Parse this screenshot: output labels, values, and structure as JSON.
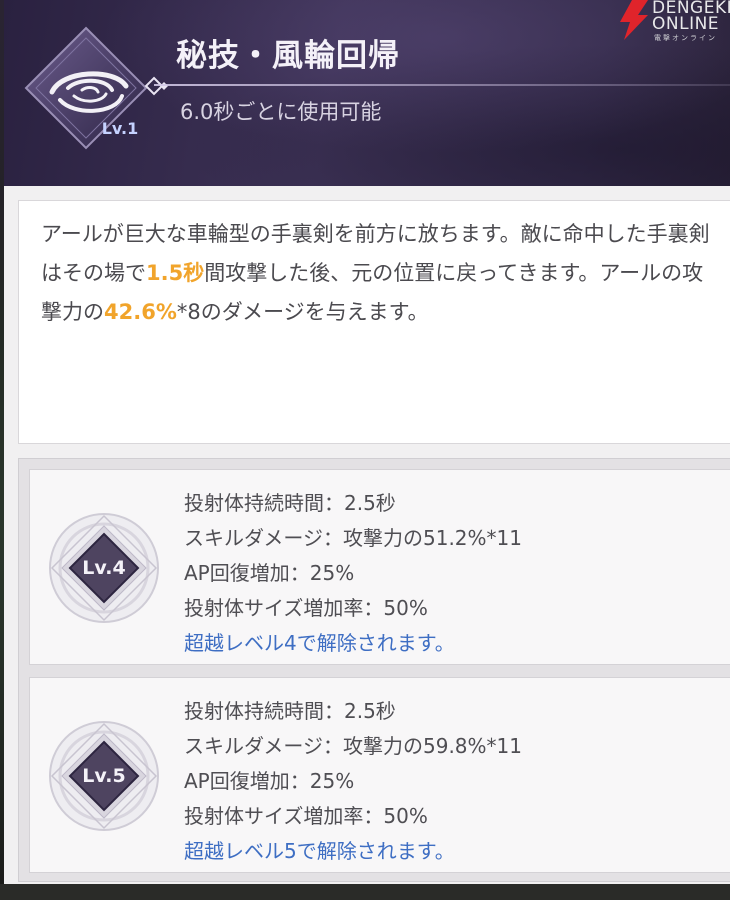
{
  "header": {
    "title": "秘技・風輪回帰",
    "level_badge": "Lv.1",
    "cooldown": "6.0秒ごとに使用可能"
  },
  "watermark": {
    "line1": "DENGEKI",
    "line2": "ONLINE",
    "line3": "電撃オンライン"
  },
  "description": {
    "seg1": "アールが巨大な車輪型の手裏剣を前方に放ちます。敵に命中した手裏剣はその場で",
    "hl1": "1.5秒",
    "seg2": "間攻撃した後、元の位置に戻ってきます。アールの攻撃力の",
    "hl2": "42.6%",
    "seg3": "*8のダメージを与えます。"
  },
  "upgrades": [
    {
      "level": "Lv.4",
      "duration": "投射体持続時間：2.5秒",
      "damage": "スキルダメージ：攻撃力の51.2%*11",
      "ap": "AP回復増加：25%",
      "size": "投射体サイズ増加率：50%",
      "unlock": "超越レベル4で解除されます。"
    },
    {
      "level": "Lv.5",
      "duration": "投射体持続時間：2.5秒",
      "damage": "スキルダメージ：攻撃力の59.8%*11",
      "ap": "AP回復増加：25%",
      "size": "投射体サイズ増加率：50%",
      "unlock": "超越レベル5で解除されます。"
    }
  ],
  "colors": {
    "highlight": "#f1a42b",
    "unlock_text": "#3e6ec3",
    "header_bg": "#3d3256",
    "watermark_red": "#e0242b"
  }
}
